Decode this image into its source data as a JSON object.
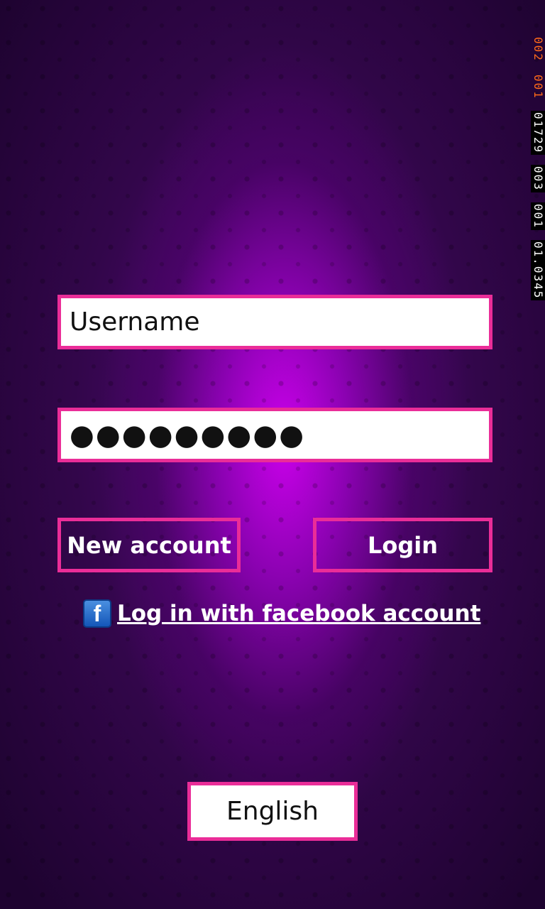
{
  "form": {
    "username_placeholder": "Username",
    "password_masked": "●●●●●●●●●",
    "new_account_label": "New account",
    "login_label": "Login",
    "facebook_link_label": "Log in with facebook account",
    "facebook_icon_glyph": "f",
    "language_label": "English"
  },
  "debug_counters": [
    "002",
    "001",
    "01729",
    "003",
    "001",
    "01.0345"
  ],
  "colors": {
    "accent_border": "#ea2d98",
    "glow": "#d000f0",
    "background_dark": "#1e0330",
    "facebook_blue": "#1456b8"
  },
  "icons": [
    "facebook-icon"
  ]
}
